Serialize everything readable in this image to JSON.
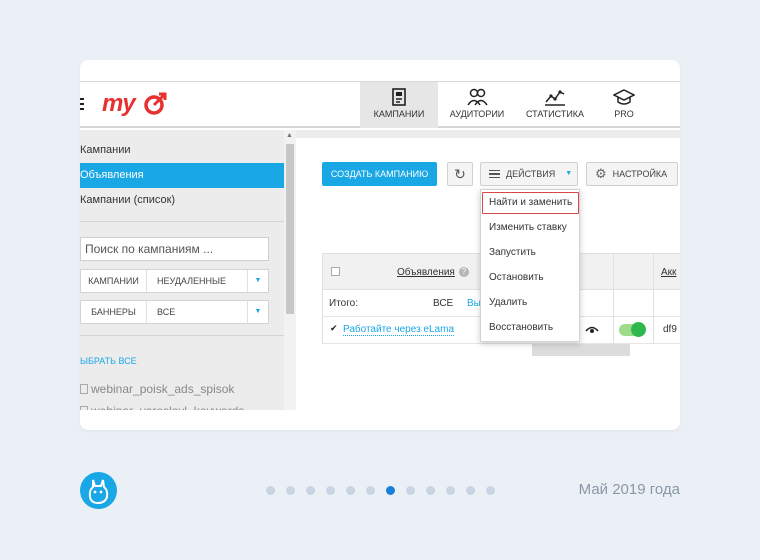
{
  "header": {
    "logo_text": "my",
    "nav": [
      {
        "label": "КАМПАНИИ",
        "active": true
      },
      {
        "label": "АУДИТОРИИ",
        "active": false
      },
      {
        "label": "СТАТИСТИКА",
        "active": false
      },
      {
        "label": "PRO",
        "active": false
      }
    ]
  },
  "sidebar": {
    "items": [
      {
        "label": "Кампании",
        "selected": false
      },
      {
        "label": "Объявления",
        "selected": true
      },
      {
        "label": "Кампании (список)",
        "selected": false
      }
    ],
    "search_placeholder": "Поиск по кампаниям ...",
    "filter1": {
      "left": "КАМПАНИИ",
      "right": "НЕУДАЛЕННЫЕ",
      "caret": "▼"
    },
    "filter2": {
      "left": "БАННЕРЫ",
      "right": "ВСЕ",
      "caret": "▼"
    },
    "select_all": "ЫБРАТЬ ВСЕ",
    "campaigns": [
      "webinar_poisk_ads_spisok",
      "webinar_yaroslavl_keywords"
    ]
  },
  "toolbar": {
    "create_label": "СОЗДАТЬ КАМПАНИЮ",
    "refresh_icon": "↻",
    "actions_label": "ДЕЙСТВИЯ",
    "actions_caret": "▼",
    "settings_icon": "⚙",
    "settings_label": "НАСТРОЙКА"
  },
  "actions_menu": [
    "Найти и заменить",
    "Изменить ставку",
    "Запустить",
    "Остановить",
    "Удалить",
    "Восстановить"
  ],
  "table": {
    "header_col": "Объявления",
    "help_icon": "?",
    "account_col": "Акк",
    "total_label": "Итого:",
    "total_all": "ВСЕ",
    "total_link": "Вы",
    "row": {
      "name": "Работайте через eLama",
      "account": "df9"
    }
  },
  "footer": {
    "date": "Май 2019 года",
    "dots_total": 12,
    "dots_active_index": 6
  },
  "colors": {
    "accent": "#1aa7e6",
    "logo_red": "#e8312f",
    "toggle_green": "#2fb84d",
    "highlight_red": "#d94848"
  }
}
